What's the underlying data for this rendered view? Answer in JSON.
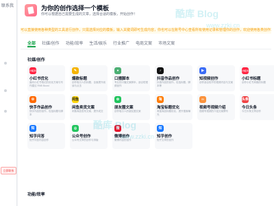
{
  "sidebar": {
    "title": "联系我",
    "tag": "立即联系"
  },
  "header": {
    "title": "为你的创作选择一个模板",
    "subtitle": "你可以根据自己需要生成的文章，选择合适的模板，开始创作！"
  },
  "notice": "可以直接使用各种类型的工具进行创作，只需选择对应的模板，输入关键词即可生成内容，你也可以在账号中心查看所有使用记录和管理你的创作，欢迎使用各类创作工具进行高效写作。",
  "tabs": [
    "全部",
    "社媒/创作",
    "功能/效率",
    "生活/娱乐",
    "行业推广",
    "电商文案",
    "市场文案"
  ],
  "sections": [
    {
      "title": "社媒/创作"
    },
    {
      "title": "功能/效率"
    }
  ],
  "cards": [
    {
      "title": "小红书优化",
      "desc": "面向小红书笔记的优化方案与写作建议 RNB Boost",
      "icon_text": "小红书",
      "icon_name": "xiaohongshu-icon",
      "color": "#ff2442"
    },
    {
      "title": "爆款标题",
      "desc": "创作吸引人的标题，全面提升阅读与点击",
      "icon_text": "✎",
      "icon_name": "pen-icon",
      "color": "#f5b301"
    },
    {
      "title": "口播脚本",
      "desc": "专业的口播文案脚本，适合短视频创作",
      "icon_text": "●",
      "icon_name": "mic-icon",
      "color": "#4caf73"
    },
    {
      "title": "抖音作品创作",
      "desc": "抖音作品的创作，包括标题、脚本等",
      "icon_text": "♪",
      "icon_name": "tiktok-icon",
      "color": "#111111"
    },
    {
      "title": "知视频创作",
      "desc": "创作适合知乎的视频内容与文案",
      "icon_text": "▶",
      "icon_name": "video-icon",
      "color": "#3b6cf6"
    },
    {
      "title": "小红书标题",
      "desc": "创作小红书风格的标题",
      "icon_text": "小红书",
      "icon_name": "xiaohongshu-title-icon",
      "color": "#ff2442"
    },
    {
      "title": "快手作品创作",
      "desc": "快手作品的创作，包括标题与脚本",
      "icon_text": "⚙",
      "icon_name": "kuaishou-icon",
      "color": "#ff6a00"
    },
    {
      "title": "闲鱼卖货文案",
      "desc": "闲鱼商品发布文案，提升成交",
      "icon_text": "闲鱼",
      "icon_name": "xianyu-icon",
      "color": "#ffd60a"
    },
    {
      "title": "朋友圈文案",
      "desc": "创作吸引人的朋友圈文案",
      "icon_text": "✿",
      "icon_name": "moments-icon",
      "color": "#22c55e"
    },
    {
      "title": "淘宝标题优化",
      "desc": "淘宝商品标题优化，提升搜索曝光",
      "icon_text": "淘",
      "icon_name": "taobao-icon",
      "color": "#ff7a00"
    },
    {
      "title": "视频号视频介绍",
      "desc": "视频号视频的介绍文案撰写",
      "icon_text": "∞",
      "icon_name": "channels-icon",
      "color": "#fb923c"
    },
    {
      "title": "今日头条",
      "desc": "今日头条文章创作",
      "icon_text": "头条",
      "icon_name": "toutiao-icon",
      "color": "#f04142"
    },
    {
      "title": "知乎问答",
      "desc": "知乎问答内容创作",
      "icon_text": "知",
      "icon_name": "zhihu-qa-icon",
      "color": "#1677ff"
    },
    {
      "title": "公众号创作",
      "desc": "公众号文章的创作与排版",
      "icon_text": "◎",
      "icon_name": "wechat-official-icon",
      "color": "#22c55e"
    },
    {
      "title": "微博创作",
      "desc": "微博内容的创作",
      "icon_text": "微",
      "icon_name": "weibo-icon",
      "color": "#e6162d"
    },
    {
      "title": "知乎创作",
      "desc": "知乎文章的创作",
      "icon_text": "知",
      "icon_name": "zhihu-icon",
      "color": "#1677ff"
    }
  ],
  "watermarks": {
    "big": "酷库 Blog",
    "url": "www.zzki.cn"
  }
}
